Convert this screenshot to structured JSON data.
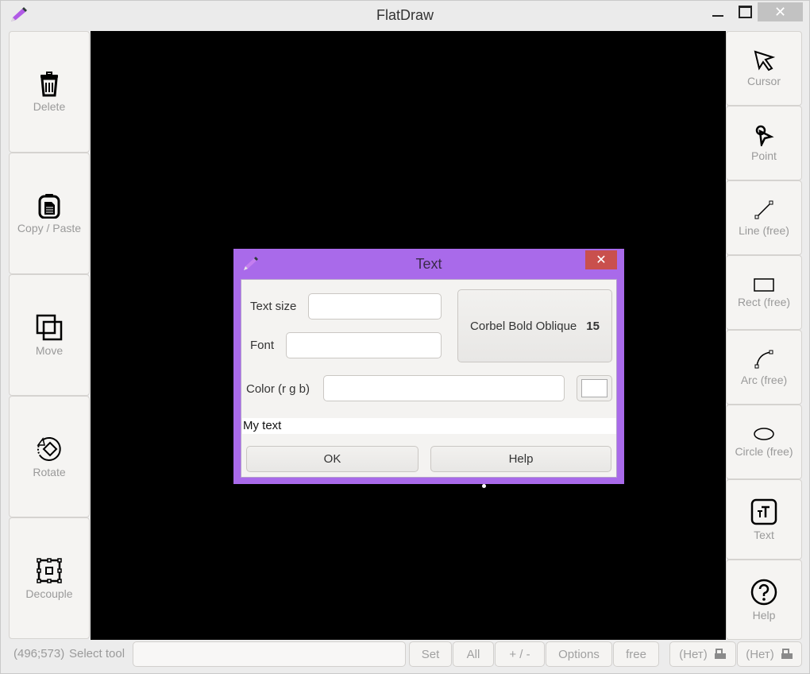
{
  "window": {
    "title": "FlatDraw",
    "app_icon": "pencil-icon",
    "controls": {
      "minimize": "minimize-icon",
      "maximize": "maximize-icon",
      "close": "✕"
    }
  },
  "left_toolbar": [
    {
      "label": "Delete",
      "icon": "trash-icon"
    },
    {
      "label": "Copy / Paste",
      "icon": "clipboard-icon"
    },
    {
      "label": "Move",
      "icon": "move-icon"
    },
    {
      "label": "Rotate",
      "icon": "rotate-icon"
    },
    {
      "label": "Decouple",
      "icon": "decouple-icon"
    }
  ],
  "right_toolbar": [
    {
      "label": "Cursor",
      "icon": "cursor-icon"
    },
    {
      "label": "Point",
      "icon": "point-icon"
    },
    {
      "label": "Line (free)",
      "icon": "line-icon"
    },
    {
      "label": "Rect (free)",
      "icon": "rect-icon"
    },
    {
      "label": "Arc (free)",
      "icon": "arc-icon"
    },
    {
      "label": "Circle (free)",
      "icon": "circle-icon"
    },
    {
      "label": "Text",
      "icon": "text-icon"
    },
    {
      "label": "Help",
      "icon": "help-icon"
    }
  ],
  "statusbar": {
    "coords": "(496;573)",
    "hint": "Select tool",
    "input_value": "",
    "buttons": [
      "Set",
      "All",
      "+ / -",
      "Options",
      "free"
    ],
    "printer_buttons": [
      "(Нет)",
      "(Нет)"
    ]
  },
  "dialog": {
    "title": "Text",
    "close": "✕",
    "text_size_label": "Text size",
    "text_size_value": "",
    "font_label": "Font",
    "font_value": "",
    "font_button_name": "Corbel Bold Oblique",
    "font_button_size": "15",
    "color_label": "Color (r g b)",
    "color_value": "",
    "color_swatch": "#ffffff",
    "preview_text": "My text",
    "ok_label": "OK",
    "help_label": "Help",
    "accent_color": "#a96aea"
  }
}
